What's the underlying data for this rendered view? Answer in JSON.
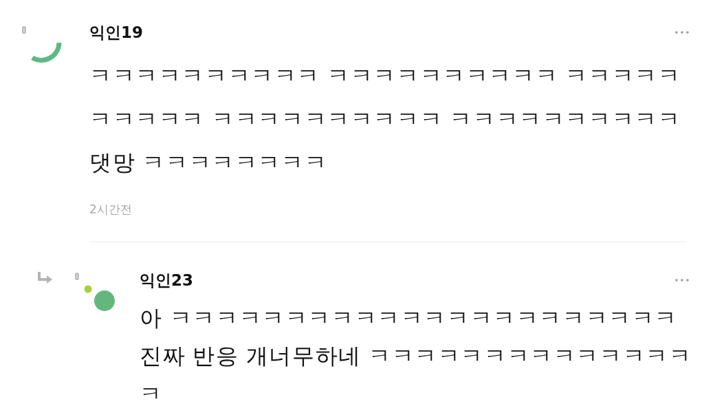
{
  "comments": [
    {
      "author": "익인19",
      "body": "ㅋㅋㅋㅋㅋㅋㅋㅋㅋㅋ ㅋㅋㅋㅋㅋㅋㅋㅋㅋㅋ ㅋㅋㅋㅋㅋㅋㅋㅋㅋㅋ ㅋㅋㅋㅋㅋㅋㅋㅋㅋㅋ ㅋㅋㅋㅋㅋㅋㅋㅋㅋㅋ 댓망 ㅋㅋㅋㅋㅋㅋㅋㅋ",
      "time": "2시간전",
      "replies": [
        {
          "author": "익인23",
          "body": "아 ㅋㅋㅋㅋㅋㅋㅋㅋㅋㅋㅋㅋㅋㅋㅋㅋㅋㅋㅋㅋㅋㅋ 진짜 반응 개너무하네 ㅋㅋㅋㅋㅋㅋㅋㅋㅋㅋㅋㅋㅋㅋㅋ"
        }
      ]
    }
  ]
}
